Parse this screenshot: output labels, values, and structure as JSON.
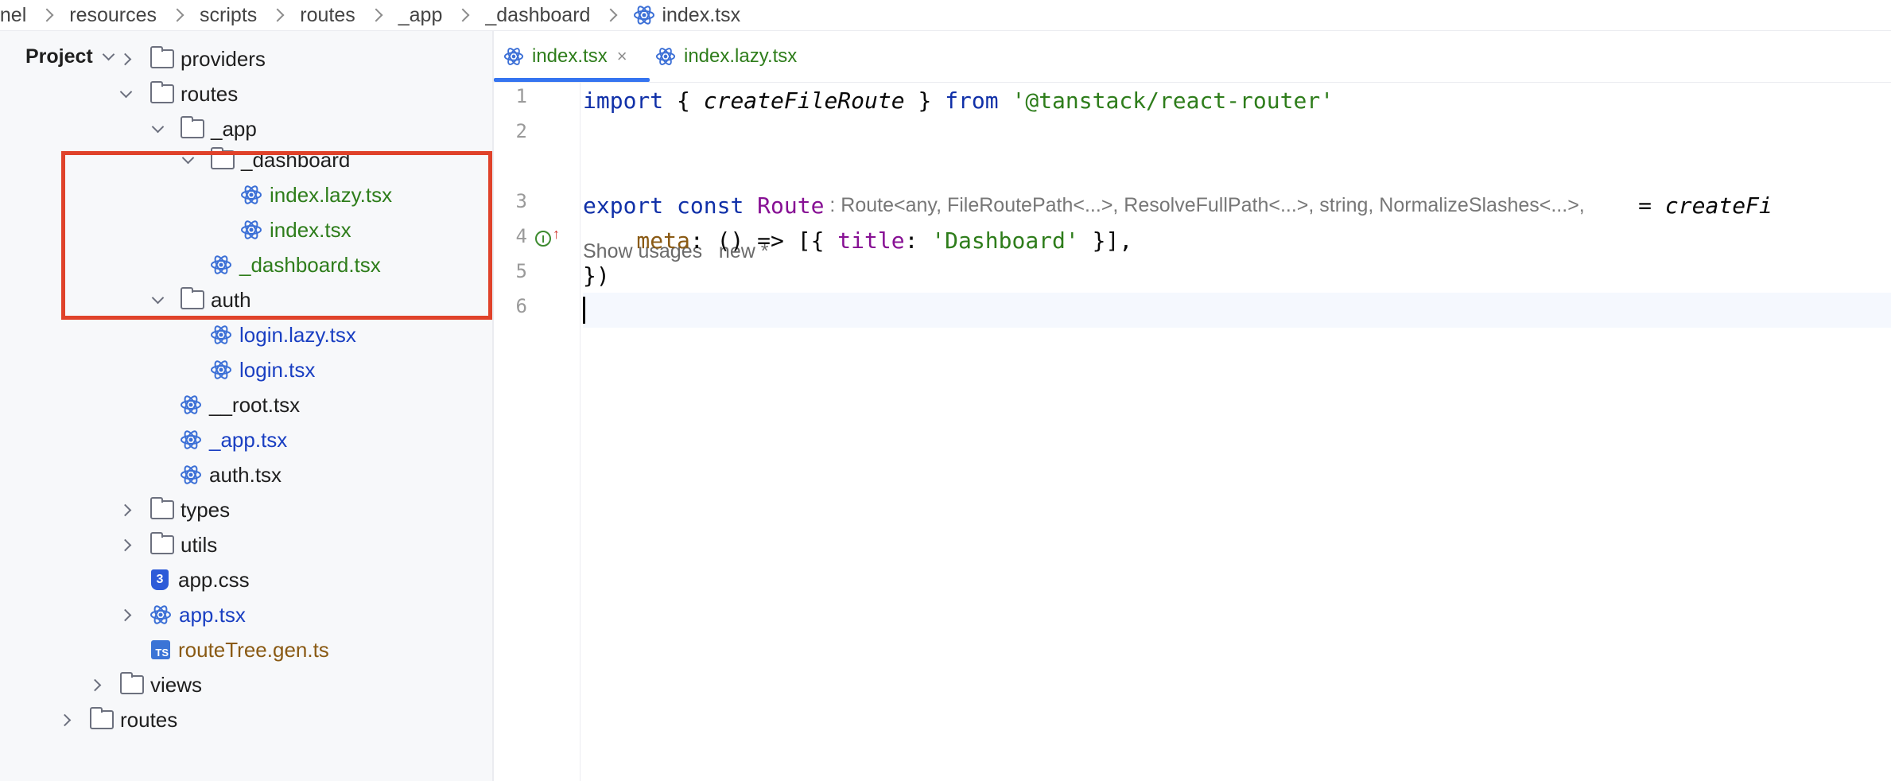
{
  "breadcrumb": {
    "items": [
      "anel",
      "resources",
      "scripts",
      "routes",
      "_app",
      "_dashboard",
      "index.tsx"
    ]
  },
  "project": {
    "title": "Project",
    "tree": [
      {
        "label": "providers",
        "type": "folder"
      },
      {
        "label": "routes",
        "type": "folder"
      },
      {
        "label": "_app",
        "type": "folder"
      },
      {
        "label": "_dashboard",
        "type": "folder"
      },
      {
        "label": "index.lazy.tsx",
        "type": "react"
      },
      {
        "label": "index.tsx",
        "type": "react"
      },
      {
        "label": "_dashboard.tsx",
        "type": "react"
      },
      {
        "label": "auth",
        "type": "folder"
      },
      {
        "label": "login.lazy.tsx",
        "type": "react"
      },
      {
        "label": "login.tsx",
        "type": "react"
      },
      {
        "label": "__root.tsx",
        "type": "react"
      },
      {
        "label": "_app.tsx",
        "type": "react"
      },
      {
        "label": "auth.tsx",
        "type": "react"
      },
      {
        "label": "types",
        "type": "folder"
      },
      {
        "label": "utils",
        "type": "folder"
      },
      {
        "label": "app.css",
        "type": "css"
      },
      {
        "label": "app.tsx",
        "type": "react"
      },
      {
        "label": "routeTree.gen.ts",
        "type": "ts"
      },
      {
        "label": "views",
        "type": "folder"
      },
      {
        "label": "routes",
        "type": "folder"
      }
    ]
  },
  "tabs": [
    {
      "label": "index.tsx",
      "close": "×"
    },
    {
      "label": "index.lazy.tsx"
    }
  ],
  "editor": {
    "line_numbers": [
      "1",
      "2",
      "3",
      "4",
      "5",
      "6"
    ],
    "usages": "Show usages   new *",
    "line1": {
      "kw1": "import",
      "p1": " { ",
      "fn": "createFileRoute",
      "p2": " } ",
      "kw2": "from",
      "str": " '@tanstack/react-router'"
    },
    "line3": {
      "kw1": "export",
      "kw2": " const",
      "name": " Route",
      "hint": " : Route<any, FileRoutePath<...>, ResolveFullPath<...>, string, NormalizeSlashes<...>,",
      "eq": "    = ",
      "fn": "createFi"
    },
    "line4": {
      "prop": "    meta",
      "p1": ": () => [{ ",
      "key": "title",
      "p2": ": ",
      "str": "'Dashboard'",
      "p3": " }],"
    },
    "line5": "})"
  },
  "colors": {
    "highlight": "#e0422a",
    "react_icon": "#3b6fd6",
    "active_tab": "#3574f0"
  }
}
